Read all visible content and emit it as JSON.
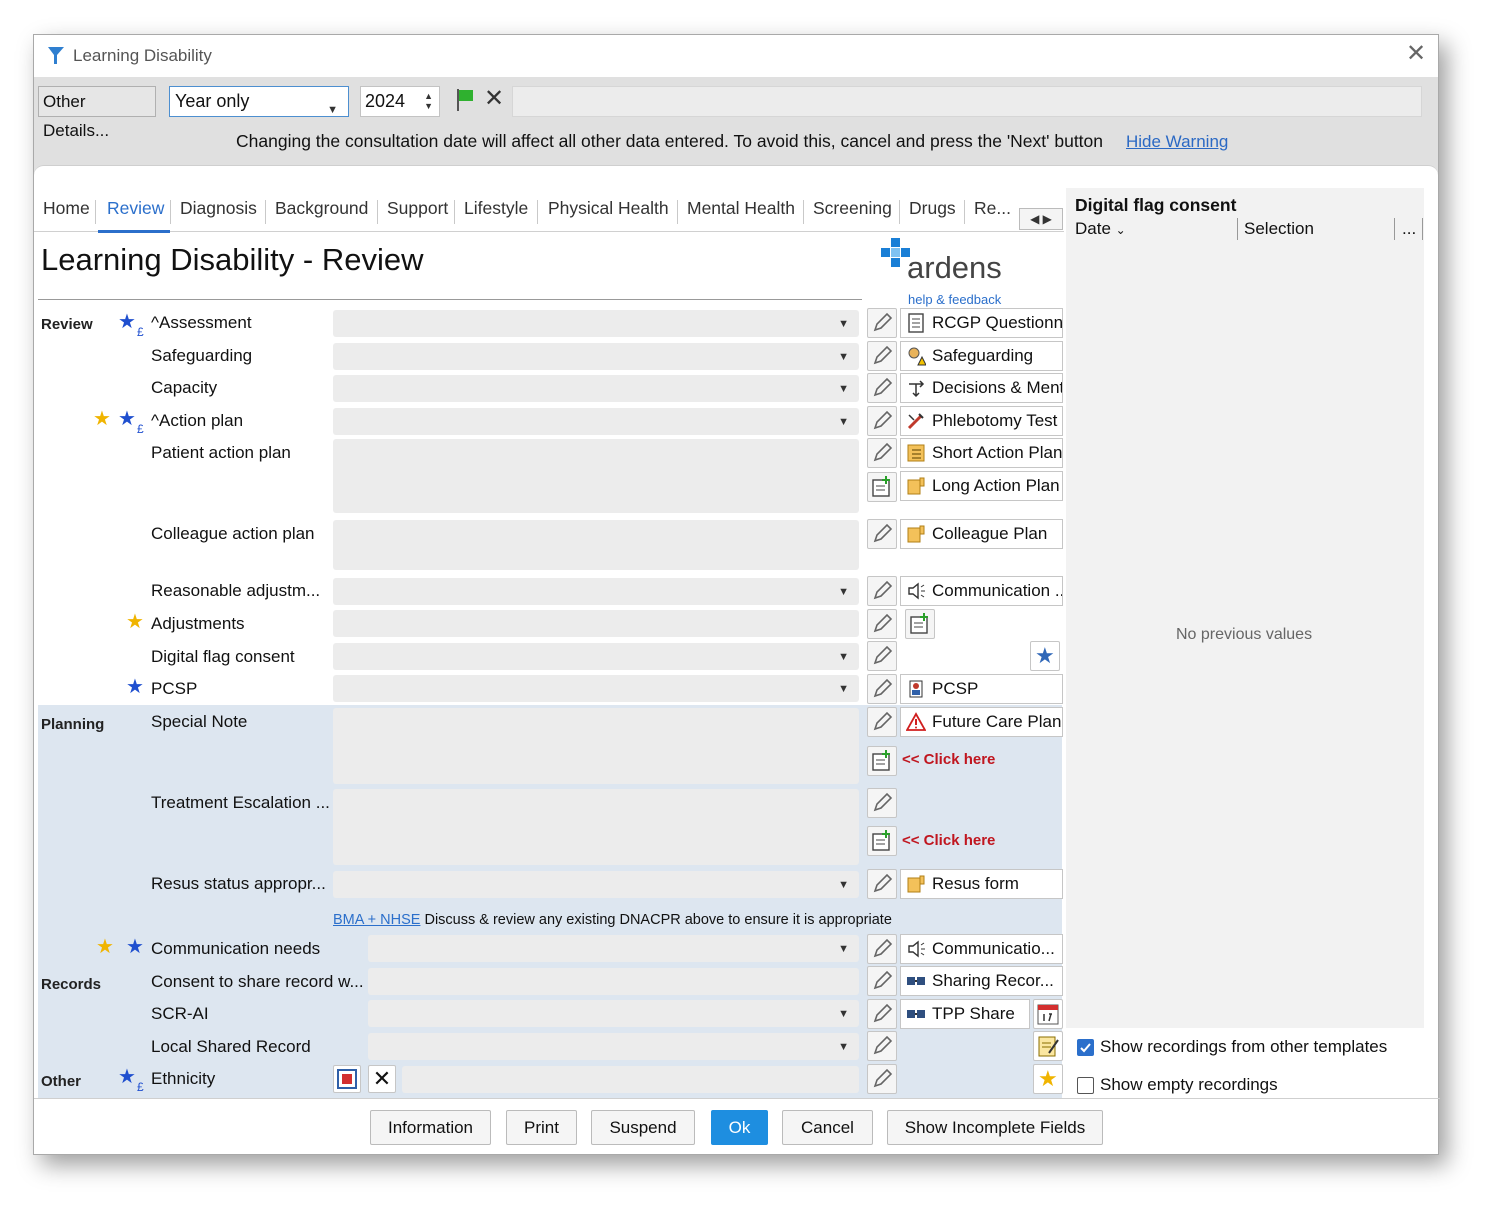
{
  "window": {
    "title": "Learning Disability"
  },
  "toolbar": {
    "other_details": "Other Details...",
    "date_mode": "Year only",
    "year": "2024",
    "warning": "Changing the consultation date will affect all other data entered. To avoid this, cancel and press the 'Next' button",
    "hide_warning": "Hide Warning"
  },
  "tabs": [
    "Home",
    "Review",
    "Diagnosis",
    "Background",
    "Support",
    "Lifestyle",
    "Physical Health",
    "Mental Health",
    "Screening",
    "Drugs",
    "Re..."
  ],
  "active_tab": "Review",
  "page": {
    "title": "Learning Disability - Review",
    "logo_text": "ardens",
    "help_link": "help & feedback"
  },
  "sections": {
    "review": "Review",
    "planning": "Planning",
    "records": "Records",
    "other": "Other"
  },
  "fields": {
    "assessment": "^Assessment",
    "safeguarding": "Safeguarding",
    "capacity": "Capacity",
    "action_plan": "^Action plan",
    "patient_action_plan": "Patient action plan",
    "colleague_action_plan": "Colleague action plan",
    "reasonable_adjustments": "Reasonable adjustm...",
    "adjustments": "Adjustments",
    "digital_flag_consent": "Digital flag consent",
    "pcsp": "PCSP",
    "special_note": "Special Note",
    "treatment_escalation": "Treatment Escalation ...",
    "resus_status": "Resus status appropr...",
    "communication_needs": "Communication needs",
    "consent_share": "Consent to share record w...",
    "scr_ai": "SCR-AI",
    "local_shared_record": "Local Shared Record",
    "ethnicity": "Ethnicity"
  },
  "pound_sign": "£",
  "resources": {
    "rcgp": "RCGP Questionnaire",
    "safeguarding": "Safeguarding",
    "decisions": "Decisions & Mental Capacity",
    "phlebotomy": "Phlebotomy Test",
    "short_plan": "Short Action Plan",
    "long_plan": "Long Action Plan",
    "colleague_plan": "Colleague Plan",
    "communication1": "Communication ..",
    "pcsp": "PCSP",
    "future_care": "Future Care Plan",
    "resus_form": "Resus form",
    "communication2": "Communicatio...",
    "sharing_record": "Sharing Recor...",
    "tpp_share": "TPP Share"
  },
  "click_here": "<< Click here",
  "note": {
    "link": "BMA + NHSE",
    "text": " Discuss & review any existing DNACPR above to ensure it is appropriate"
  },
  "right_panel": {
    "title": "Digital flag consent",
    "col_date": "Date",
    "col_selection": "Selection",
    "col_more": "...",
    "empty": "No previous values",
    "show_other": "Show recordings from other templates",
    "show_other_checked": true,
    "show_empty": "Show empty recordings",
    "show_empty_checked": false
  },
  "footer": {
    "information": "Information",
    "print": "Print",
    "suspend": "Suspend",
    "ok": "Ok",
    "cancel": "Cancel",
    "show_incomplete": "Show Incomplete Fields"
  },
  "colors": {
    "accent": "#2b6fcb",
    "primary_button": "#1e8ee0",
    "planning_bg": "#dde6f0",
    "click_here": "#c0161f",
    "star_blue": "#1f4fcf",
    "star_gold": "#f0b400"
  }
}
